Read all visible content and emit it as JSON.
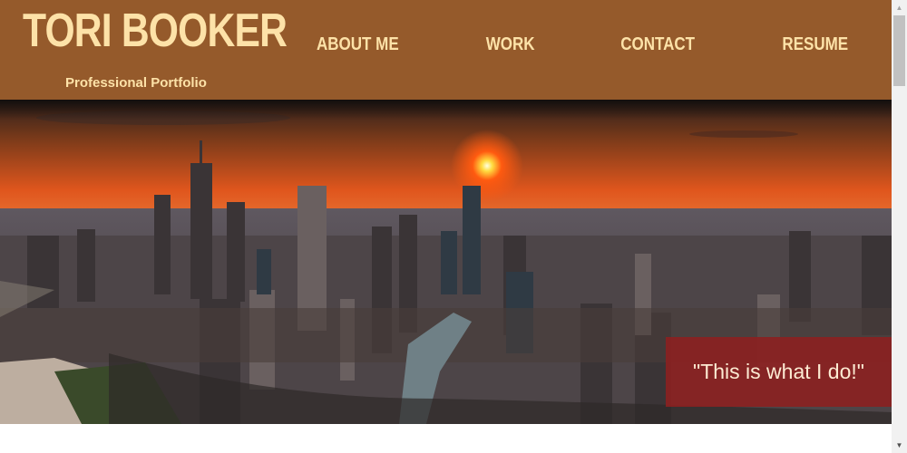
{
  "header": {
    "name": "TORI BOOKER",
    "tagline": "Professional Portfolio"
  },
  "nav": {
    "items": [
      {
        "label": "ABOUT ME"
      },
      {
        "label": "WORK"
      },
      {
        "label": "CONTACT"
      },
      {
        "label": "RESUME"
      }
    ]
  },
  "hero": {
    "quote": "\"This is what I do!\""
  },
  "colors": {
    "header_bg": "#955a2b",
    "header_text": "#fde2a8",
    "quote_bg": "#8c2020",
    "quote_text": "#fdebd3"
  },
  "icons": {
    "scroll_up": "caret-up-icon",
    "scroll_down": "caret-down-icon"
  }
}
